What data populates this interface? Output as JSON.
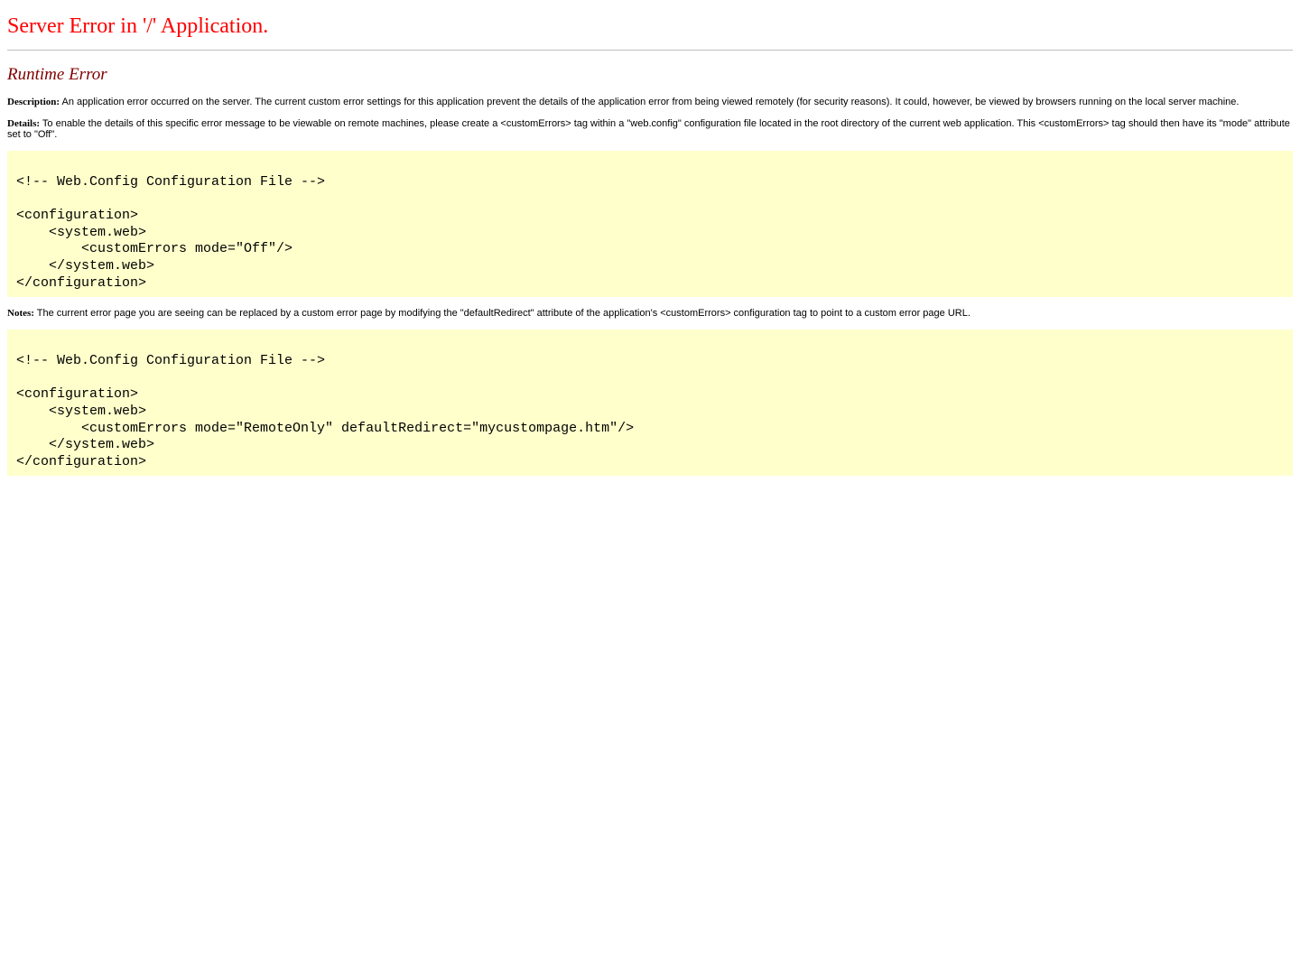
{
  "title": "Server Error in '/' Application.",
  "subtitle": "Runtime Error",
  "description": {
    "label": "Description:",
    "text": " An application error occurred on the server. The current custom error settings for this application prevent the details of the application error from being viewed remotely (for security reasons). It could, however, be viewed by browsers running on the local server machine."
  },
  "details": {
    "label": "Details:",
    "text": " To enable the details of this specific error message to be viewable on remote machines, please create a <customErrors> tag within a \"web.config\" configuration file located in the root directory of the current web application. This <customErrors> tag should then have its \"mode\" attribute set to \"Off\"."
  },
  "code1": "<!-- Web.Config Configuration File -->\n\n<configuration>\n    <system.web>\n        <customErrors mode=\"Off\"/>\n    </system.web>\n</configuration>",
  "notes": {
    "label": "Notes:",
    "text": " The current error page you are seeing can be replaced by a custom error page by modifying the \"defaultRedirect\" attribute of the application's <customErrors> configuration tag to point to a custom error page URL."
  },
  "code2": "<!-- Web.Config Configuration File -->\n\n<configuration>\n    <system.web>\n        <customErrors mode=\"RemoteOnly\" defaultRedirect=\"mycustompage.htm\"/>\n    </system.web>\n</configuration>",
  "colors": {
    "title": "#ff0000",
    "subtitle": "#800000",
    "code_background": "#ffffcc",
    "rule": "#c0c0c0"
  }
}
